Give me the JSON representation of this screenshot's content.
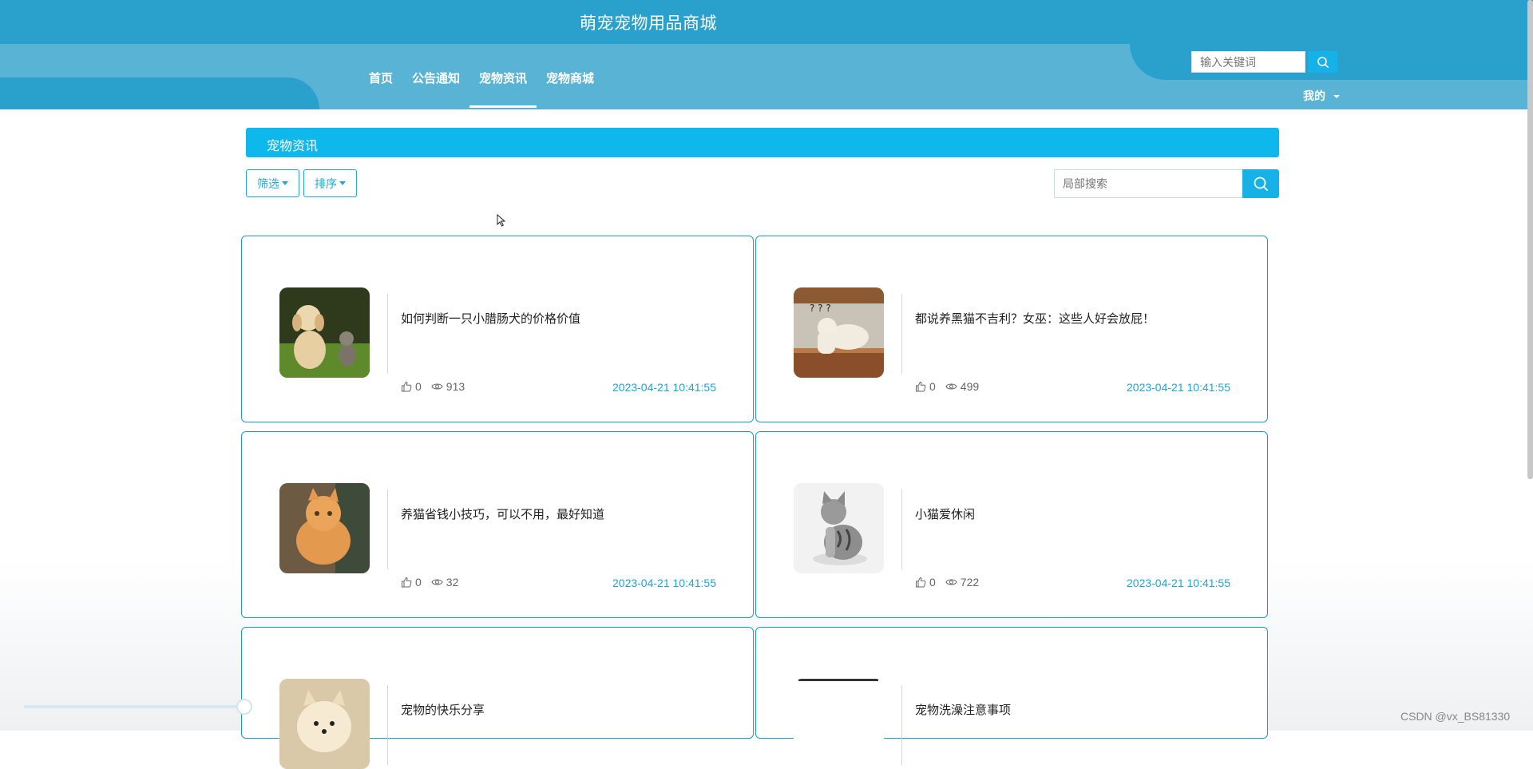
{
  "header": {
    "site_title": "萌宠宠物用品商城"
  },
  "nav": [
    {
      "label": "首页"
    },
    {
      "label": "公告通知"
    },
    {
      "label": "宠物资讯"
    },
    {
      "label": "宠物商城"
    }
  ],
  "nav_active": "宠物资讯",
  "search": {
    "placeholder": "输入关键词"
  },
  "user_menu": {
    "label": "我的"
  },
  "section": {
    "title": "宠物资讯",
    "filter_label": "筛选",
    "sort_label": "排序",
    "local_search_placeholder": "局部搜索"
  },
  "articles": [
    {
      "title": "如何判断一只小腊肠犬的价格价值",
      "likes": "0",
      "views": "913",
      "date": "2023-04-21 10:41:55"
    },
    {
      "title": "都说养黑猫不吉利？女巫：这些人好会放屁！",
      "likes": "0",
      "views": "499",
      "date": "2023-04-21 10:41:55"
    },
    {
      "title": "养猫省钱小技巧，可以不用，最好知道",
      "likes": "0",
      "views": "32",
      "date": "2023-04-21 10:41:55"
    },
    {
      "title": "小猫爱休闲",
      "likes": "0",
      "views": "722",
      "date": "2023-04-21 10:41:55"
    },
    {
      "title": "宠物的快乐分享",
      "likes": "",
      "views": "",
      "date": ""
    },
    {
      "title": "宠物洗澡注意事项",
      "likes": "",
      "views": "",
      "date": ""
    }
  ],
  "watermark": "CSDN @vx_BS81330",
  "colors": {
    "header": "#2aa1cc",
    "nav_band": "#59b3d5",
    "accent": "#0fb8ec",
    "card_border": "#1a9cc8"
  }
}
